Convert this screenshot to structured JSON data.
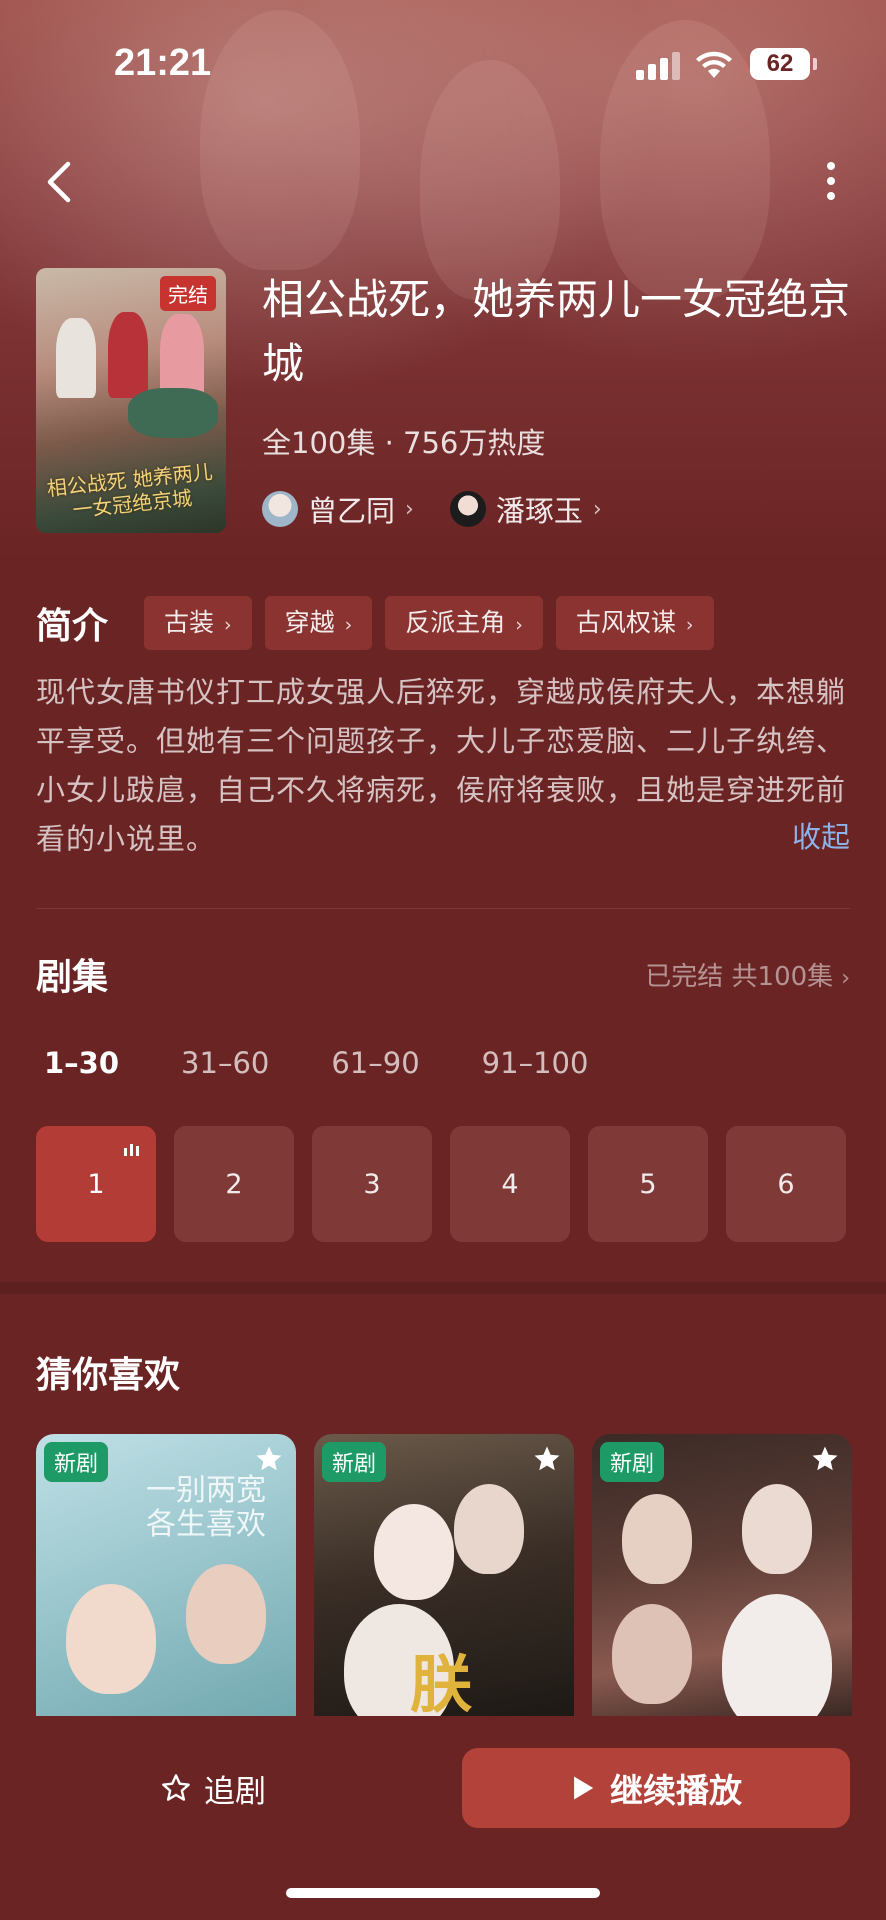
{
  "status_bar": {
    "time": "21:21",
    "battery": "62"
  },
  "nav": {
    "back_icon": "chevron-left-icon",
    "more_icon": "more-vertical-icon"
  },
  "drama": {
    "badge": "完结",
    "poster_title": "相公战死 她养两儿一女冠绝京城",
    "title": "相公战死，她养两儿一女冠绝京城",
    "meta": "全100集 · 756万热度",
    "cast": [
      {
        "name": "曾乙同"
      },
      {
        "name": "潘琢玉"
      }
    ]
  },
  "intro": {
    "label": "简介",
    "tags": [
      "古装",
      "穿越",
      "反派主角",
      "古风权谋"
    ],
    "text": "现代女唐书仪打工成女强人后猝死，穿越成侯府夫人，本想躺平享受。但她有三个问题孩子，大儿子恋爱脑、二儿子纨绔、小女儿跋扈，自己不久将病死，侯府将衰败，且她是穿进死前看的小说里。",
    "collapse": "收起"
  },
  "episodes": {
    "label": "剧集",
    "status": "已完结 共100集",
    "ranges": [
      "1–30",
      "31–60",
      "61–90",
      "91–100"
    ],
    "active_range": 0,
    "items": [
      "1",
      "2",
      "3",
      "4",
      "5",
      "6"
    ],
    "active_item": 0
  },
  "recommend": {
    "label": "猜你喜欢",
    "cards": [
      {
        "badge": "新剧",
        "title_art": "一别两宽 各生喜欢"
      },
      {
        "badge": "新剧",
        "title_art": "朕"
      },
      {
        "badge": "新剧",
        "title_art": ""
      }
    ]
  },
  "actions": {
    "follow": "追剧",
    "play": "继续播放"
  },
  "colors": {
    "background": "#6b2424",
    "accent": "#b3433a",
    "badge_new": "#1e9a66",
    "link": "#8db2e8"
  }
}
